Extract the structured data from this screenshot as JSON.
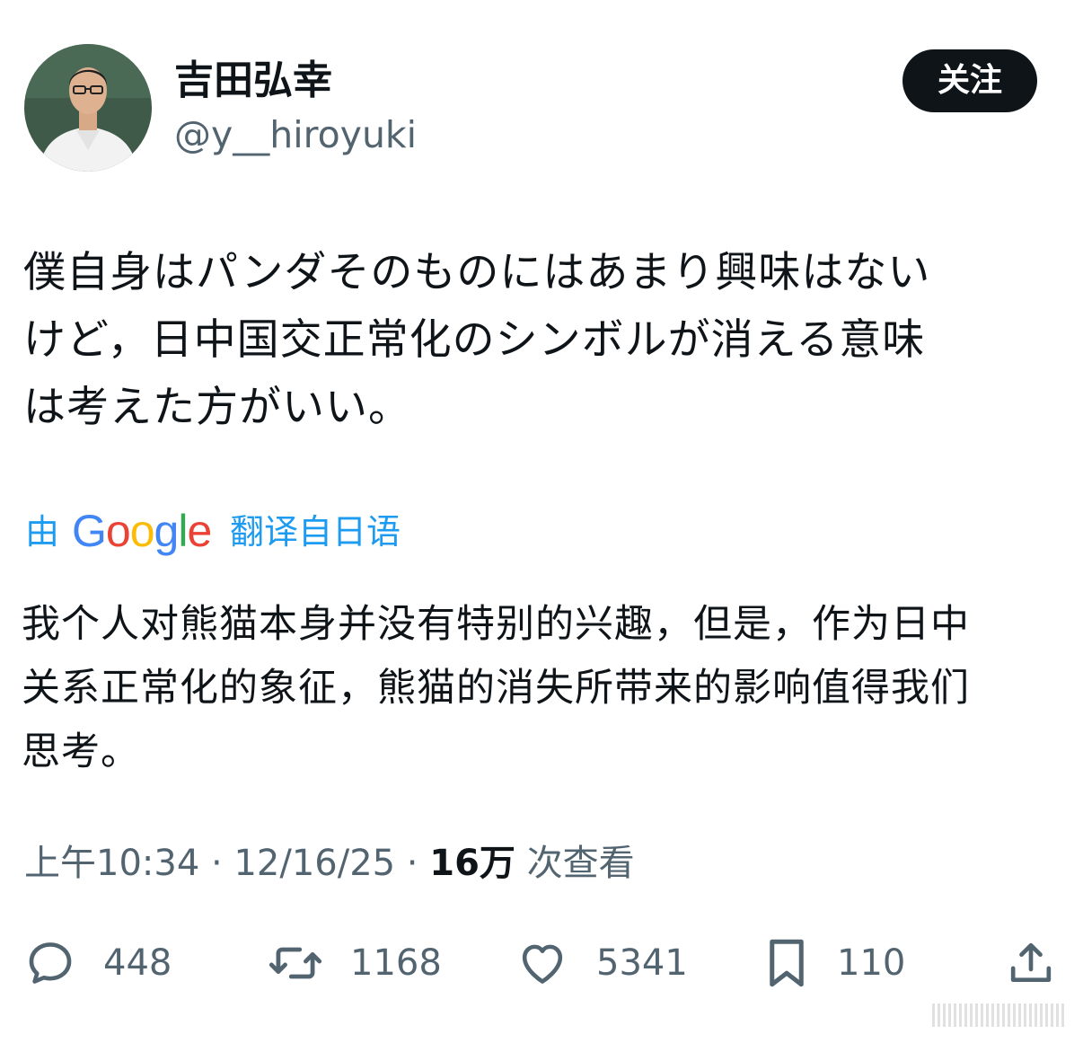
{
  "author": {
    "display_name": "吉田弘幸",
    "handle": "@y__hiroyuki"
  },
  "follow_label": "关注",
  "tweet": {
    "text": "僕自身はパンダそのものにはあまり興味はない\nけど，日中国交正常化のシンボルが消える意味\nは考えた方がいい。"
  },
  "translation": {
    "prefix": "由",
    "provider": "Google",
    "suffix": "翻译自日语",
    "text": "我个人对熊猫本身并没有特别的兴趣，但是，作为日中\n关系正常化的象征，熊猫的消失所带来的影响值得我们\n思考。"
  },
  "meta": {
    "time": "上午10:34",
    "separator": " · ",
    "date": "12/16/25",
    "views_count": "16万",
    "views_label": " 次查看"
  },
  "actions": {
    "replies": "448",
    "retweets": "1168",
    "likes": "5341",
    "bookmarks": "110"
  },
  "icons": {
    "reply": "reply-icon",
    "retweet": "retweet-icon",
    "like": "heart-icon",
    "bookmark": "bookmark-icon",
    "share": "share-icon"
  },
  "colors": {
    "text": "#0f1419",
    "secondary": "#536471",
    "link": "#1d9bf0",
    "follow_bg": "#0f1419"
  }
}
